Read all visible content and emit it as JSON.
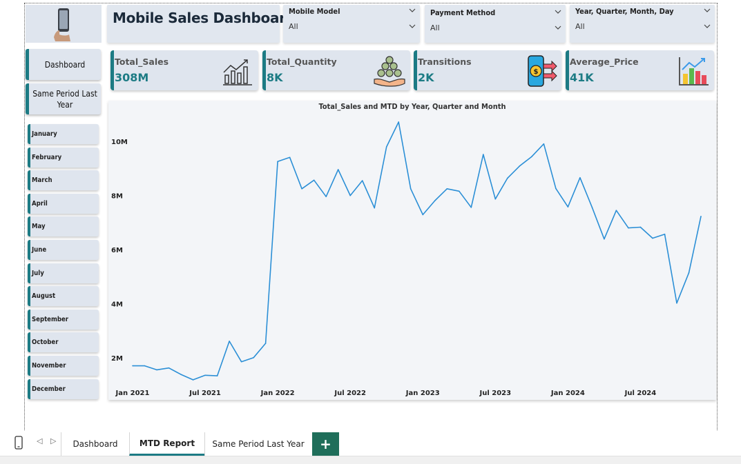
{
  "header": {
    "title": "Mobile Sales Dashboard"
  },
  "slicers": [
    {
      "label": "Mobile Model",
      "value": "All"
    },
    {
      "label": "Payment Method",
      "value": "All"
    },
    {
      "label": "Year, Quarter, Month, Day",
      "value": "All"
    }
  ],
  "kpis": [
    {
      "label": "Total_Sales",
      "value": "308M",
      "icon": "growth-chart-icon"
    },
    {
      "label": "Total_Quantity",
      "value": "8K",
      "icon": "coins-hand-icon"
    },
    {
      "label": "Transitions",
      "value": "2K",
      "icon": "phone-transfer-icon"
    },
    {
      "label": "Average_Price",
      "value": "41K",
      "icon": "bar-chart-icon"
    }
  ],
  "nav": {
    "dashboard": "Dashboard",
    "same_period": "Same Period Last Year"
  },
  "months": [
    "January",
    "February",
    "March",
    "April",
    "May",
    "June",
    "July",
    "August",
    "September",
    "October",
    "November",
    "December"
  ],
  "chart_data": {
    "type": "line",
    "title": "Total_Sales and MTD by Year, Quarter and Month",
    "xlabel": "",
    "ylabel": "",
    "x": [
      "Jan 2021",
      "Feb 2021",
      "Mar 2021",
      "Apr 2021",
      "May 2021",
      "Jun 2021",
      "Jul 2021",
      "Aug 2021",
      "Sep 2021",
      "Oct 2021",
      "Nov 2021",
      "Dec 2021",
      "Jan 2022",
      "Feb 2022",
      "Mar 2022",
      "Apr 2022",
      "May 2022",
      "Jun 2022",
      "Jul 2022",
      "Aug 2022",
      "Sep 2022",
      "Oct 2022",
      "Nov 2022",
      "Dec 2022",
      "Jan 2023",
      "Feb 2023",
      "Mar 2023",
      "Apr 2023",
      "May 2023",
      "Jun 2023",
      "Jul 2023",
      "Aug 2023",
      "Sep 2023",
      "Oct 2023",
      "Nov 2023",
      "Dec 2023",
      "Jan 2024",
      "Feb 2024",
      "Mar 2024",
      "Apr 2024",
      "May 2024",
      "Jun 2024",
      "Jul 2024",
      "Aug 2024",
      "Sep 2024",
      "Oct 2024",
      "Nov 2024",
      "Dec 2024"
    ],
    "tick_labels": [
      "Jan 2021",
      "Jul 2021",
      "Jan 2022",
      "Jul 2022",
      "Jan 2023",
      "Jul 2023",
      "Jan 2024",
      "Jul 2024"
    ],
    "y_tick_labels": [
      "2M",
      "4M",
      "6M",
      "8M",
      "10M"
    ],
    "y_ticks": [
      2000000,
      4000000,
      6000000,
      8000000,
      10000000
    ],
    "series": [
      {
        "values": [
          1700000,
          1700000,
          1550000,
          1620000,
          1380000,
          1180000,
          1350000,
          1330000,
          2610000,
          1850000,
          2000000,
          2530000,
          9260000,
          9410000,
          8250000,
          8570000,
          7960000,
          8960000,
          8000000,
          8550000,
          7540000,
          9800000,
          10720000,
          8250000,
          7290000,
          7810000,
          8250000,
          8160000,
          7560000,
          9520000,
          7870000,
          8640000,
          9090000,
          9440000,
          9910000,
          8260000,
          7580000,
          8660000,
          7560000,
          6390000,
          7450000,
          6800000,
          6830000,
          6420000,
          6570000,
          4020000,
          5140000,
          7230000
        ]
      }
    ],
    "ylim": [
      1000000,
      11000000
    ],
    "color": "#2b8fd6",
    "grid": false
  },
  "tabs": {
    "items": [
      "Dashboard",
      "MTD Report",
      "Same Period Last Year"
    ],
    "active": "MTD Report",
    "add": "+"
  }
}
